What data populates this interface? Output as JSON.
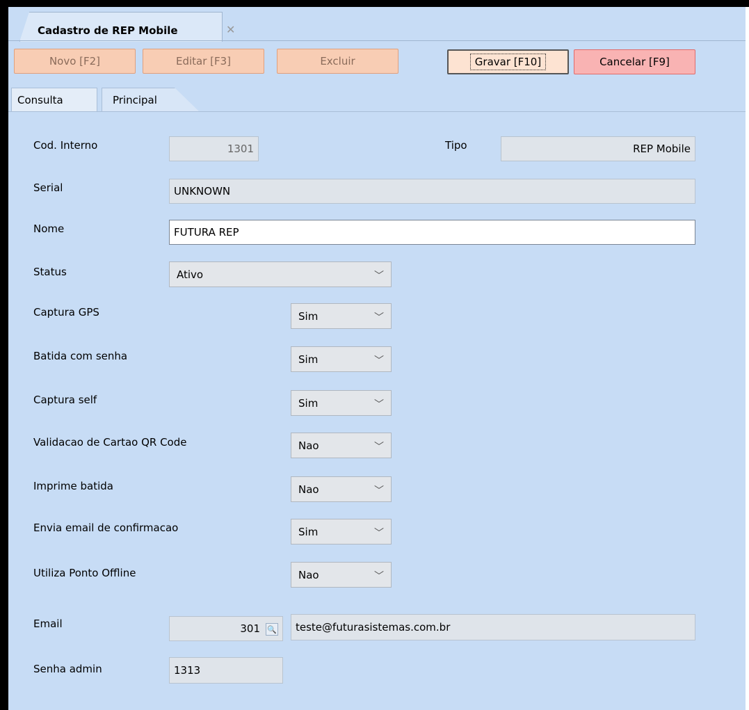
{
  "window": {
    "tab_title": "Cadastro de REP Mobile"
  },
  "toolbar": {
    "novo": "Novo [F2]",
    "editar": "Editar [F3]",
    "excluir": "Excluir",
    "gravar": "Gravar [F10]",
    "cancelar": "Cancelar [F9]"
  },
  "tabs": {
    "consulta": "Consulta",
    "principal": "Principal"
  },
  "form": {
    "cod_interno": {
      "label": "Cod. Interno",
      "value": "1301"
    },
    "tipo": {
      "label": "Tipo",
      "value": "REP Mobile"
    },
    "serial": {
      "label": "Serial",
      "value": "UNKNOWN"
    },
    "nome": {
      "label": "Nome",
      "value": "FUTURA REP"
    },
    "status": {
      "label": "Status",
      "value": "Ativo"
    },
    "captura_gps": {
      "label": "Captura GPS",
      "value": "Sim"
    },
    "batida_com_senha": {
      "label": "Batida com senha",
      "value": "Sim"
    },
    "captura_self": {
      "label": "Captura self",
      "value": "Sim"
    },
    "validacao_qr": {
      "label": "Validacao de Cartao QR Code",
      "value": "Nao"
    },
    "imprime_batida": {
      "label": "Imprime batida",
      "value": "Nao"
    },
    "envia_email": {
      "label": "Envia email de confirmacao",
      "value": "Sim"
    },
    "ponto_offline": {
      "label": "Utiliza Ponto Offline",
      "value": "Nao"
    },
    "email": {
      "label": "Email",
      "code": "301",
      "address": "teste@futurasistemas.com.br"
    },
    "senha_admin": {
      "label": "Senha admin",
      "value": "1313"
    }
  },
  "icons": {
    "close": "close-icon",
    "chevron": "chevron-down-icon",
    "lookup": "search-icon"
  },
  "colors": {
    "panel": "#c7dcf5",
    "disabled_button": "#f8cdb4",
    "cancel_button": "#f9b3b3"
  }
}
